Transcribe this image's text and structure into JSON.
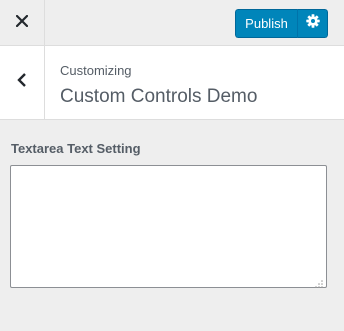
{
  "topbar": {
    "close_icon": "close-icon",
    "publish_label": "Publish",
    "settings_icon": "gear-icon"
  },
  "header": {
    "back_icon": "chevron-left-icon",
    "subtitle": "Customizing",
    "title": "Custom Controls Demo"
  },
  "setting": {
    "label": "Textarea Text Setting",
    "value": "",
    "resize_icon": "resize-handle-icon"
  },
  "colors": {
    "panel_bg": "#eeeeee",
    "header_bg": "#ffffff",
    "publish_bg": "#0085ba",
    "text": "#555d66"
  }
}
